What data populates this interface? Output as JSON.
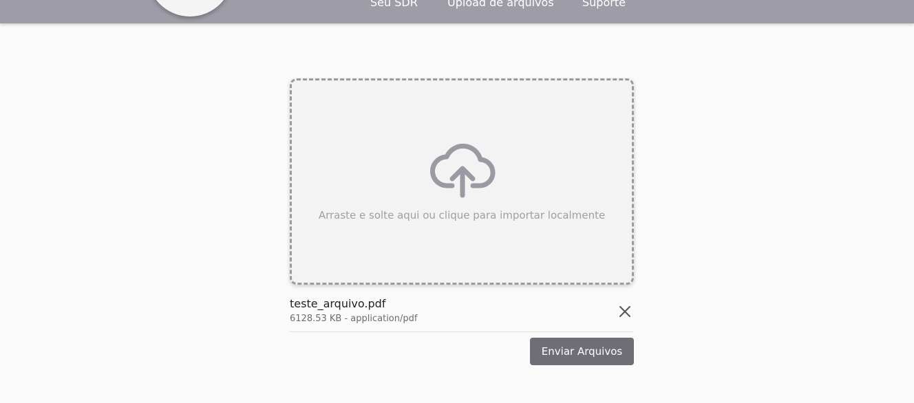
{
  "nav": {
    "items": [
      {
        "label": "Seu SDR"
      },
      {
        "label": "Upload de arquivos"
      },
      {
        "label": "Suporte"
      }
    ]
  },
  "dropzone": {
    "icon": "cloud-upload-icon",
    "text": "Arraste e solte aqui ou clique para importar localmente"
  },
  "files": [
    {
      "name": "teste_arquivo.pdf",
      "meta": "6128.53 KB - application/pdf",
      "remove_icon": "close-icon"
    }
  ],
  "actions": {
    "send_label": "Enviar Arquivos"
  },
  "colors": {
    "header": "#9d9ca7",
    "background": "#fafafa",
    "dropzone_border": "#9b9aa3",
    "button": "#6f6e76"
  }
}
